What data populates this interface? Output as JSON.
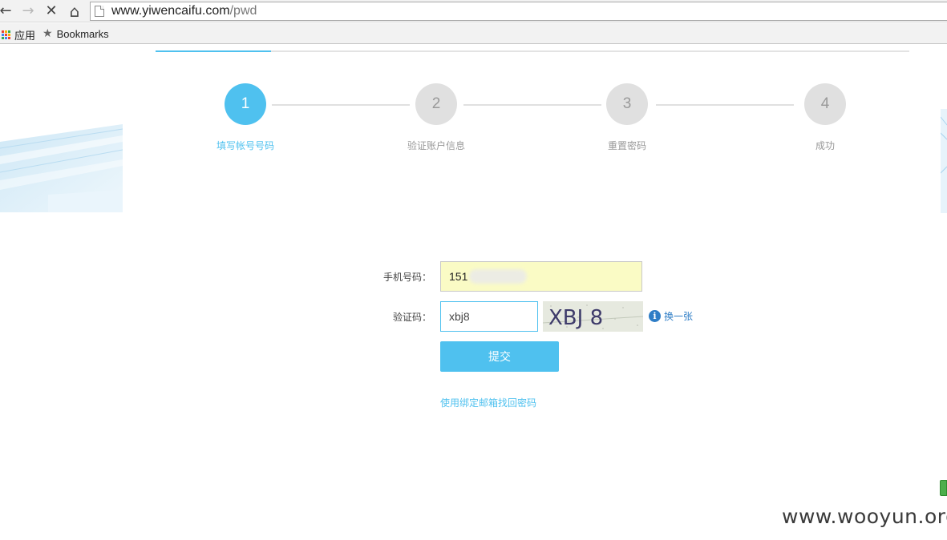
{
  "browser": {
    "nav": {
      "back_icon": "←",
      "forward_icon": "→",
      "stop_icon": "✕",
      "home_icon": "⌂"
    },
    "url_host": "www.yiwencaifu.com",
    "url_path": "/pwd",
    "bookmarks": {
      "apps_label": "应用",
      "bookmarks_label": "Bookmarks",
      "star_icon": "★"
    }
  },
  "steps": [
    {
      "number": "1",
      "label": "填写帐号号码",
      "active": true
    },
    {
      "number": "2",
      "label": "验证账户信息",
      "active": false
    },
    {
      "number": "3",
      "label": "重置密码",
      "active": false
    },
    {
      "number": "4",
      "label": "成功",
      "active": false
    }
  ],
  "form": {
    "phone_label": "手机号码：",
    "phone_value": "151",
    "code_label": "验证码：",
    "code_value": "xbj8",
    "captcha_text": "XBJ 8",
    "refresh_icon": "i",
    "refresh_label": "换一张",
    "submit_label": "提交",
    "email_link": "使用绑定邮箱找回密码"
  },
  "watermark": "www.wooyun.org",
  "colors": {
    "accent": "#4fc1ef",
    "link": "#2e7dc6",
    "inactive": "#e0e0e0",
    "autofill": "#fafbc5"
  }
}
